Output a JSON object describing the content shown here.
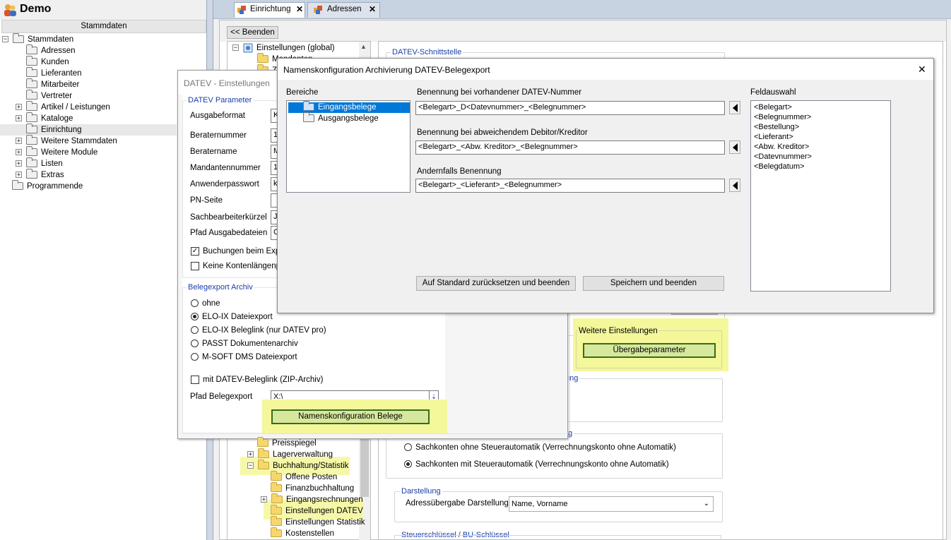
{
  "app": {
    "title": "Demo",
    "header": "Stammdaten"
  },
  "left_tree": [
    {
      "label": "Stammdaten",
      "expander": "−"
    },
    {
      "label": "Adressen"
    },
    {
      "label": "Kunden"
    },
    {
      "label": "Lieferanten"
    },
    {
      "label": "Mitarbeiter"
    },
    {
      "label": "Vertreter"
    },
    {
      "label": "Artikel / Leistungen",
      "expander": "+"
    },
    {
      "label": "Kataloge",
      "expander": "+"
    },
    {
      "label": "Einrichtung"
    },
    {
      "label": "Weitere Stammdaten",
      "expander": "+"
    },
    {
      "label": "Weitere Module",
      "expander": "+"
    },
    {
      "label": "Listen",
      "expander": "+"
    },
    {
      "label": "Extras",
      "expander": "+"
    },
    {
      "label": "Programmende"
    }
  ],
  "tabs": [
    {
      "label": "Einrichtung"
    },
    {
      "label": "Adressen"
    }
  ],
  "back_button": "<< Beenden",
  "mid_tree_top": {
    "root": "Einstellungen (global)",
    "item1": "Mandanten",
    "item2": "Z"
  },
  "mid_tree_bottom": [
    {
      "label": "Preisspiegel"
    },
    {
      "label": "Lagerverwaltung",
      "expander": "+"
    },
    {
      "label": "Buchhaltung/Statistik",
      "expander": "−"
    },
    {
      "label": "Offene Posten"
    },
    {
      "label": "Finanzbuchhaltung"
    },
    {
      "label": "Eingangsrechnungen",
      "expander": "+"
    },
    {
      "label": "Einstellungen DATEV"
    },
    {
      "label": "Einstellungen Statistik"
    },
    {
      "label": "Kostenstellen"
    }
  ],
  "right_panel": {
    "datev_group": "DATEV-Schnittstelle",
    "weitere_group": "Weitere Einstellungen",
    "uebergabe_button": "Übergabeparameter",
    "ung_fragment": "ung",
    "g_fragment": "g",
    "radio1": "Sachkonten ohne Steuerautomatik (Verrechnungskonto ohne Automatik)",
    "radio2": "Sachkonten mit Steuerautomatik (Verrechnungskonto ohne Automatik)",
    "darstellung_group": "Darstellung",
    "adress_label": "Adressübergabe Darstellung",
    "adress_value": "Name, Vorname",
    "steuer_group": "Steuerschlüssel / BU-Schlüssel"
  },
  "datev_dialog": {
    "title": "DATEV - Einstellungen",
    "params_group": "DATEV Parameter",
    "fields": [
      {
        "label": "Ausgabeformat",
        "value": "K"
      },
      {
        "label": "Beraternummer",
        "value": "1"
      },
      {
        "label": "Beratername",
        "value": "M"
      },
      {
        "label": "Mandantennummer",
        "value": "1"
      },
      {
        "label": "Anwenderpasswort",
        "value": "k"
      },
      {
        "label": "PN-Seite",
        "value": ""
      },
      {
        "label": "Sachbearbeiterkürzel",
        "value": "J"
      },
      {
        "label": "Pfad Ausgabedateien",
        "value": "C"
      }
    ],
    "check1": "Buchungen beim Exp",
    "check2": "Keine Kontenlängenp",
    "archiv_group": "Belegexport Archiv",
    "radios": [
      "ohne",
      "ELO-IX Dateiexport",
      "ELO-IX Beleglink (nur DATEV pro)",
      "PASST Dokumentenarchiv",
      "M-SOFT DMS Dateiexport"
    ],
    "zip_check": "mit DATEV-Beleglink (ZIP-Archiv)",
    "pfad_label": "Pfad Belegexport",
    "pfad_value": "X:\\",
    "namens_button": "Namenskonfiguration Belege"
  },
  "names_dialog": {
    "title": "Namenskonfiguration Archivierung DATEV-Belegexport",
    "bereiche_label": "Bereiche",
    "bereiche": [
      "Eingangsbelege",
      "Ausgangsbelege"
    ],
    "label1": "Benennung bei vorhandener DATEV-Nummer",
    "value1": "<Belegart>_D<Datevnummer>_<Belegnummer>",
    "label2": "Benennung bei abweichendem Debitor/Kreditor",
    "value2": "<Belegart>_<Abw. Kreditor>_<Belegnummer>",
    "label3": "Andernfalls Benennung",
    "value3": "<Belegart>_<Lieferant>_<Belegnummer>",
    "feldauswahl_label": "Feldauswahl",
    "felder": [
      "<Belegart>",
      "<Belegnummer>",
      "<Bestellung>",
      "<Lieferant>",
      "<Abw. Kreditor>",
      "<Datevnummer>",
      "<Belegdatum>"
    ],
    "reset_button": "Auf Standard zurücksetzen und beenden",
    "save_button": "Speichern und beenden",
    "close": "✕"
  }
}
